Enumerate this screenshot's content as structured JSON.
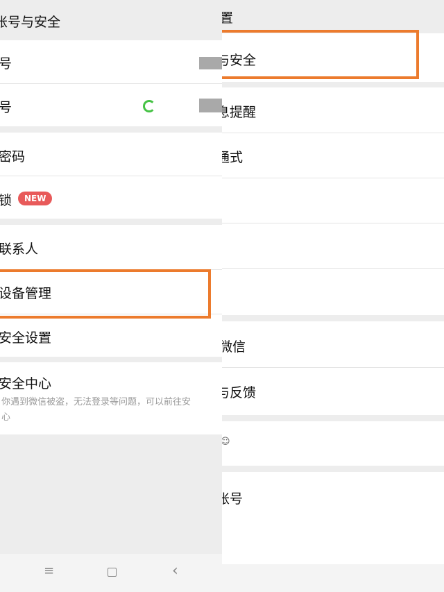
{
  "left": {
    "header_title": "账号与安全",
    "section1": [
      {
        "label": "号"
      },
      {
        "label": "号"
      }
    ],
    "section2": [
      {
        "label": "密码"
      },
      {
        "label": "锁",
        "badge": "NEW"
      }
    ],
    "section3": [
      {
        "label": "联系人"
      },
      {
        "label": "设备管理"
      },
      {
        "label": "安全设置"
      }
    ],
    "security_center": {
      "title": "安全中心",
      "desc_line1": "你遇到微信被盗，无法登录等问题，可以前往安",
      "desc_line2": "心"
    },
    "highlight_color": "#ec7b2d",
    "badge_color": "#e85a5a",
    "nav": {
      "menu_icon": "≡",
      "back_icon": "‹"
    }
  },
  "right": {
    "header_title": "置",
    "items": [
      {
        "label": "与安全"
      },
      {
        "label": "息提醒"
      },
      {
        "label": "通式"
      },
      {
        "label": ""
      },
      {
        "label": ""
      },
      {
        "label": ""
      },
      {
        "label": "微信"
      },
      {
        "label": "与反馈"
      },
      {
        "label": "☺"
      },
      {
        "label": "账号"
      }
    ]
  }
}
